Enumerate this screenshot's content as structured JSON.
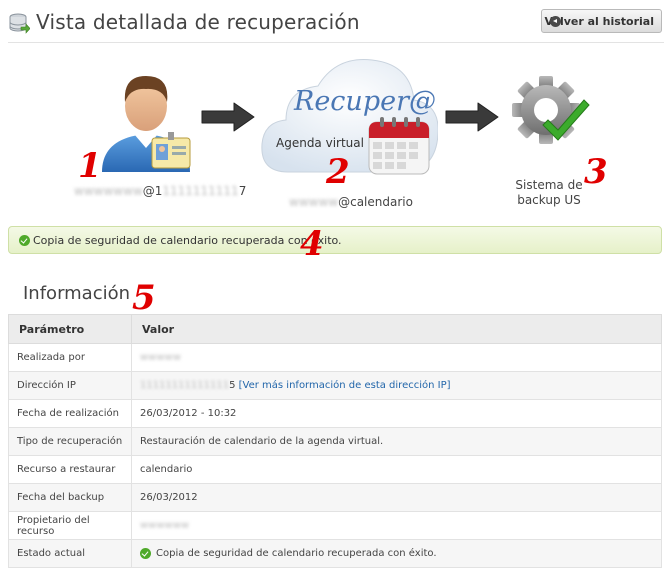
{
  "header": {
    "title": "Vista detallada de recuperación",
    "back_button": "Volver al historial"
  },
  "flow": {
    "source_label": "@1",
    "source_suffix": "7",
    "cloud_title": "Recuper@",
    "cloud_subtitle": "Agenda virtual",
    "target_label": "@calendario",
    "backup_label_line1": "Sistema de",
    "backup_label_line2": "backup US",
    "step_numbers": [
      "1",
      "2",
      "3",
      "4",
      "5"
    ]
  },
  "status": {
    "message": "Copia de seguridad de calendario recuperada con éxito."
  },
  "info": {
    "title": "Información",
    "columns": [
      "Parámetro",
      "Valor"
    ],
    "rows": [
      {
        "key": "Realizada por",
        "value": ""
      },
      {
        "key": "Dirección IP",
        "value": "5",
        "link": "[Ver más información de esta dirección IP]"
      },
      {
        "key": "Fecha de realización",
        "value": "26/03/2012 - 10:32"
      },
      {
        "key": "Tipo de recuperación",
        "value": "Restauración de calendario de la agenda virtual."
      },
      {
        "key": "Recurso a restaurar",
        "value": "calendario"
      },
      {
        "key": "Fecha del backup",
        "value": "26/03/2012"
      },
      {
        "key": "Propietario del recurso",
        "value": ""
      },
      {
        "key": "Estado actual",
        "value": "Copia de seguridad de calendario recuperada con éxito."
      }
    ]
  },
  "colors": {
    "accent_red": "#e00000",
    "success_green": "#4fa92a",
    "link_blue": "#2266aa"
  },
  "icons": [
    "database-restore-icon",
    "user-icon",
    "id-card-icon",
    "arrow-right-icon",
    "cloud-icon",
    "calendar-icon",
    "gear-icon",
    "checkmark-icon",
    "back-icon",
    "success-icon"
  ]
}
